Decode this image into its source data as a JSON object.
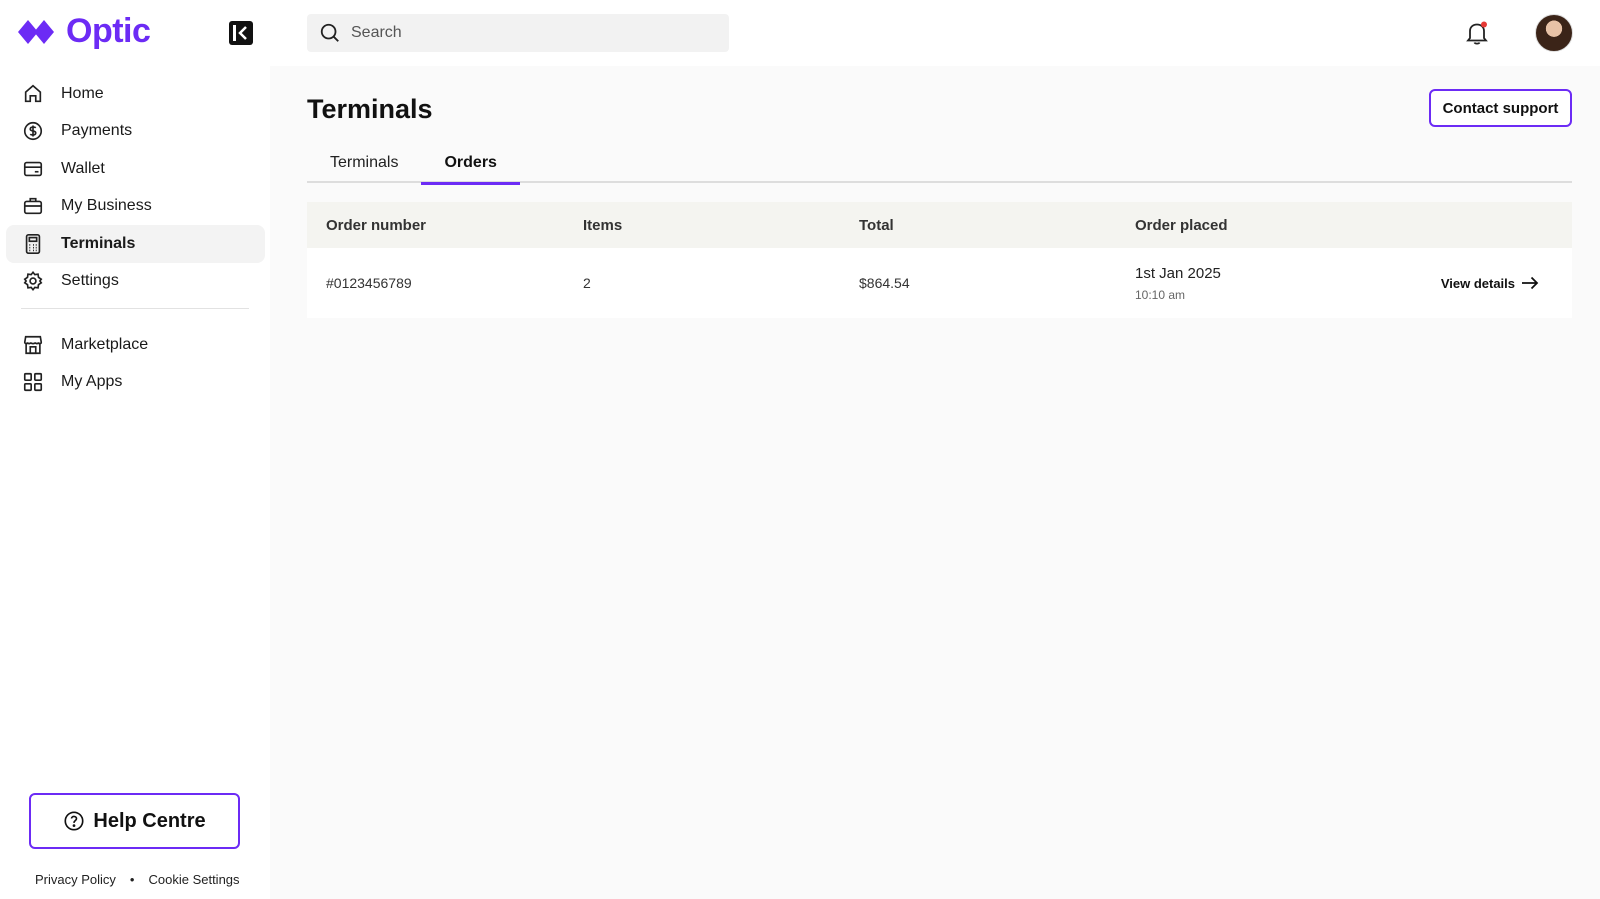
{
  "brand": {
    "name": "Optic",
    "color": "#6c2bf5"
  },
  "search": {
    "placeholder": "Search"
  },
  "sidebar": {
    "items": [
      {
        "label": "Home",
        "icon": "home-icon"
      },
      {
        "label": "Payments",
        "icon": "dollar-circle-icon"
      },
      {
        "label": "Wallet",
        "icon": "wallet-icon"
      },
      {
        "label": "My Business",
        "icon": "briefcase-icon"
      },
      {
        "label": "Terminals",
        "icon": "terminal-icon",
        "active": true
      },
      {
        "label": "Settings",
        "icon": "gear-icon"
      }
    ],
    "secondary_items": [
      {
        "label": "Marketplace",
        "icon": "store-icon"
      },
      {
        "label": "My Apps",
        "icon": "apps-grid-icon"
      }
    ],
    "help_label": "Help Centre",
    "footer": {
      "privacy": "Privacy Policy",
      "separator": "•",
      "cookies": "Cookie Settings"
    }
  },
  "header": {
    "notification_dot_color": "#e53935"
  },
  "page": {
    "title": "Terminals",
    "contact_label": "Contact support",
    "tabs": [
      {
        "label": "Terminals",
        "active": false
      },
      {
        "label": "Orders",
        "active": true
      }
    ]
  },
  "table": {
    "headers": [
      "Order number",
      "Items",
      "Total",
      "Order placed"
    ],
    "rows": [
      {
        "order_number": "#0123456789",
        "items": "2",
        "total": "$864.54",
        "date": "1st Jan 2025",
        "time": "10:10 am",
        "action": "View details"
      }
    ]
  }
}
